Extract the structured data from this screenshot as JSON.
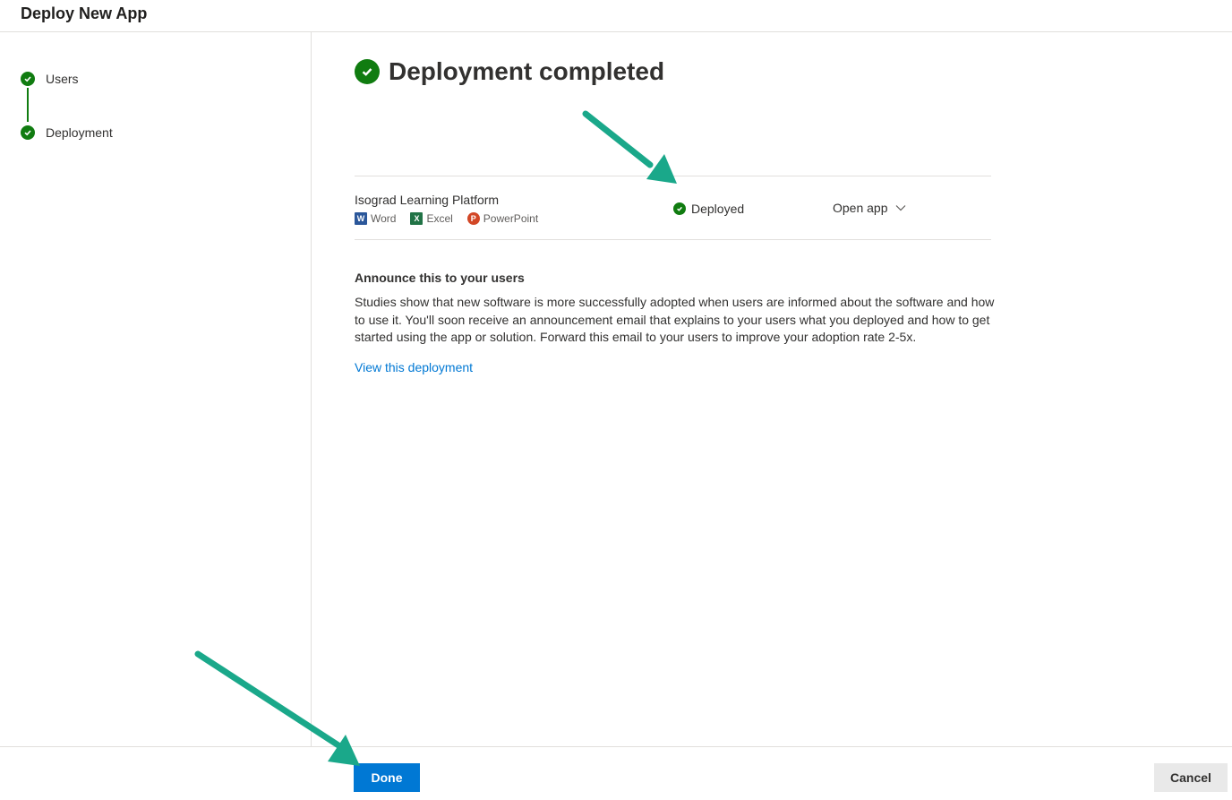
{
  "header": {
    "title": "Deploy New App"
  },
  "steps": [
    {
      "label": "Users",
      "state": "complete"
    },
    {
      "label": "Deployment",
      "state": "complete"
    }
  ],
  "main": {
    "title": "Deployment completed",
    "app": {
      "name": "Isograd Learning Platform",
      "apps": [
        {
          "label": "Word",
          "icon": "word-icon"
        },
        {
          "label": "Excel",
          "icon": "excel-icon"
        },
        {
          "label": "PowerPoint",
          "icon": "powerpoint-icon"
        }
      ],
      "status": "Deployed",
      "open_app_label": "Open app"
    },
    "announce": {
      "heading": "Announce this to your users",
      "body": "Studies show that new software is more successfully adopted when users are informed about the software and how to use it. You'll soon receive an announcement email that explains to your users what you deployed and how to get started using the app or solution. Forward this email to your users to improve your adoption rate 2-5x.",
      "link": "View this deployment"
    }
  },
  "footer": {
    "done_label": "Done",
    "cancel_label": "Cancel"
  },
  "colors": {
    "accent": "#0078d4",
    "success": "#107c10",
    "annotation_arrow": "#1aa88a"
  }
}
